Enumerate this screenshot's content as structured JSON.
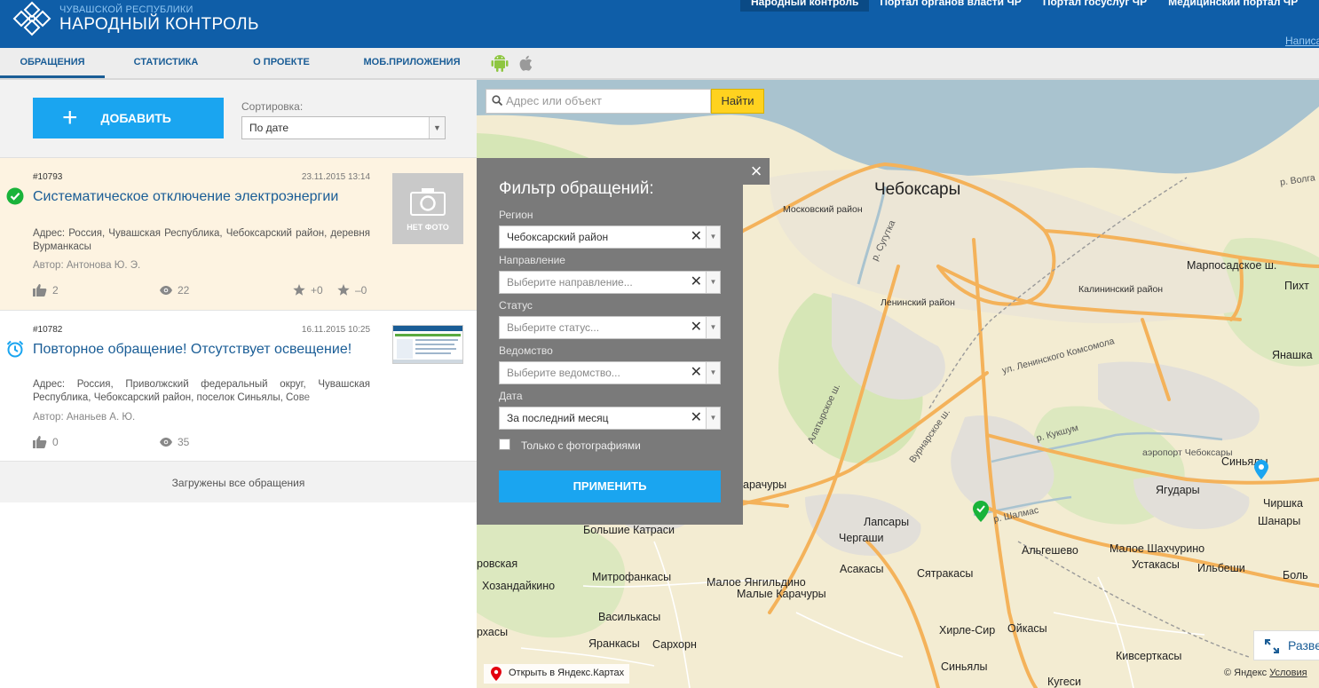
{
  "header": {
    "brand_small": "ЧУВАШСКОЙ РЕСПУБЛИКИ",
    "brand_big": "НАРОДНЫЙ КОНТРОЛЬ",
    "portals": [
      "Народный контроль",
      "Портал органов власти ЧР",
      "Портал госуслуг ЧР",
      "Медицинский портал ЧР"
    ],
    "login": "Написать"
  },
  "tabs": {
    "items": [
      "ОБРАЩЕНИЯ",
      "СТАТИСТИКА",
      "О ПРОЕКТЕ",
      "МОБ.ПРИЛОЖЕНИЯ"
    ],
    "active": "ОБРАЩЕНИЯ",
    "apps": [
      "android-icon",
      "apple-icon"
    ]
  },
  "toolbar": {
    "add_label": "ДОБАВИТЬ",
    "sort_label": "Сортировка:",
    "sort_value": "По дате"
  },
  "appeals": [
    {
      "number": "#10793",
      "date": "23.11.2015 13:14",
      "status": "resolved",
      "title": "Систематическое отключение электроэнергии",
      "address": "Адрес: Россия, Чувашская Республика, Чебоксарский район, деревня Вурманкасы",
      "author": "Автор: Антонова Ю. Э.",
      "likes": "2",
      "views": "22",
      "plus": "+0",
      "minus": "–0",
      "photo": "НЕТ ФОТО"
    },
    {
      "number": "#10782",
      "date": "16.11.2015 10:25",
      "status": "pending",
      "title": "Повторное обращение! Отсутствует освещение!",
      "address": "Адрес: Россия, Приволжский федеральный округ, Чувашская Республика, Чебоксарский район, поселок Синьялы, Сове",
      "author": "Автор: Ананьев А. Ю.",
      "likes": "0",
      "views": "35"
    }
  ],
  "list_footer": "Загружены все обращения",
  "map": {
    "search_placeholder": "Адрес или объект",
    "find_label": "Найти",
    "open_yandex": "Открыть в Яндекс.Картах",
    "expand": "Развернуть",
    "copyright_prefix": "© Яндекс",
    "copyright_link": "Условия",
    "labels": {
      "city": "Чебоксары",
      "moskovsky": "Московский район",
      "leninsky": "Ленинский район",
      "kalininsky": "Калининский район",
      "marposad": "Марпосадское ш.",
      "pikht": "Пихт",
      "yanashka": "Янашка",
      "volga": "р. Волга",
      "sugutka": "р. Сугутка",
      "lenkom": "ул. Ленинского Комсомола",
      "alatyr": "Алатырское ш.",
      "vurnar": "Вурнарское ш.",
      "kukshum": "р. Кукшум",
      "airport": "аэропорт Чебоксары",
      "sinyaly": "Синьялы",
      "yagudary": "Ягудары",
      "chirshka": "Чиршка",
      "shanary": "Шанары",
      "karachury": "арачуры",
      "shalmas": "р. Шалмас",
      "lapsary": "Лапсары",
      "cherghashi": "Черг­аши",
      "bolshie_katrasi": "Большие Катраси",
      "rovskaya": "ровская",
      "khozandaykino": "Хозандайкино",
      "mitrofankasy": "Митрофанкасы",
      "maloe_yangildino": "Малое Янгильдино",
      "malye_karachury": "Малые Карачуры",
      "asakasy": "Асакасы",
      "syatrakasy": "Сятракасы",
      "algeshevo": "Альгешево",
      "maloe_shakhcharino": "Малое Шахчурино",
      "ustakasy": "Устакасы",
      "ilbeshi": "Ильбеши",
      "bolsh": "Боль",
      "vasilkasy": "Василькасы",
      "yrankasy": "Яранкасы",
      "sarkhorn": "Сархорн",
      "khirle_sir": "Хирле-Сир",
      "oykasy": "Ойкасы",
      "kivsertkasy": "Кивсерткасы",
      "kugesi": "Кугеси",
      "sinyaly2": "Синьялы",
      "rkhasy": "рхасы"
    }
  },
  "filter": {
    "title": "Фильтр обращений:",
    "close": "×",
    "fields": [
      {
        "label": "Регион",
        "value": "Чебоксарский район",
        "placeholder": false
      },
      {
        "label": "Направление",
        "value": "Выберите направление...",
        "placeholder": true
      },
      {
        "label": "Статус",
        "value": "Выберите статус...",
        "placeholder": true
      },
      {
        "label": "Ведомство",
        "value": "Выберите ведомство...",
        "placeholder": true
      },
      {
        "label": "Дата",
        "value": "За последний месяц",
        "placeholder": false
      }
    ],
    "photos_only": "Только с фотографиями",
    "apply": "ПРИМЕНИТЬ"
  },
  "colors": {
    "header": "#0f5ea8",
    "accent": "#1aa5f0",
    "link": "#1a5d96",
    "find_button": "#ffd21f"
  }
}
